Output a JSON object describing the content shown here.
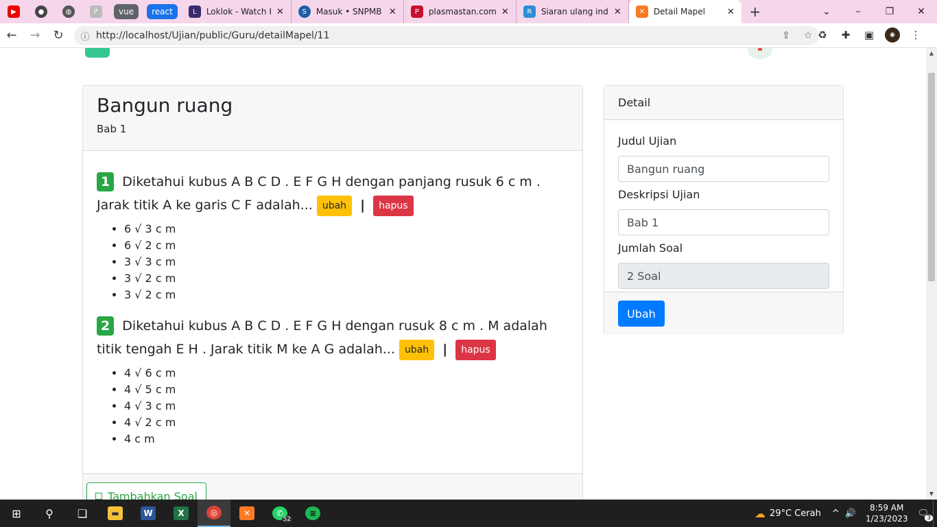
{
  "browser": {
    "pinned_icons": [
      "youtube-icon",
      "github-icon",
      "globe-icon",
      "react-devtools-icon"
    ],
    "tab_groups": [
      {
        "label": "vue",
        "color": "#5f6368"
      },
      {
        "label": "react",
        "color": "#1a73e8"
      }
    ],
    "tabs": [
      {
        "title": "Loklok - Watch HD",
        "icon": "loklok-icon"
      },
      {
        "title": "Masuk • SNPMB",
        "icon": "snpmb-icon"
      },
      {
        "title": "plasmastan.com | L",
        "icon": "plasmastan-icon"
      },
      {
        "title": "Siaran ulang indon",
        "icon": "siaran-icon"
      },
      {
        "title": "Detail Mapel",
        "icon": "xampp-icon",
        "active": true
      }
    ],
    "url": "http://localhost/Ujian/public/Guru/detailMapel/11",
    "accent": "#f6d6ea"
  },
  "page": {
    "title": "Bangun ruang",
    "subtitle": "Bab 1",
    "questions": [
      {
        "number": "1",
        "text": "Diketahui kubus A B C D . E F G H dengan panjang rusuk 6 c m . Jarak titik A ke garis C F adalah...",
        "options": [
          "6 √ 3 c m",
          "6 √ 2 c m",
          "3 √ 3 c m",
          "3 √ 2 c m",
          "3 √ 2 c m"
        ],
        "edit_label": "ubah",
        "delete_label": "hapus"
      },
      {
        "number": "2",
        "text": "Diketahui kubus A B C D . E F G H dengan rusuk 8 c m . M adalah titik tengah E H . Jarak titik M ke A G adalah...",
        "options": [
          "4 √ 6 c m",
          "4 √ 5 c m",
          "4 √ 3 c m",
          "4 √ 2 c m",
          "4 c m"
        ],
        "edit_label": "ubah",
        "delete_label": "hapus"
      }
    ],
    "separator": "|",
    "add_question_label": "Tambahkan Soal"
  },
  "detail": {
    "header": "Detail",
    "fields": [
      {
        "label": "Judul Ujian",
        "value": "Bangun ruang"
      },
      {
        "label": "Deskripsi Ujian",
        "value": "Bab 1"
      },
      {
        "label": "Jumlah Soal",
        "value": "2 Soal",
        "disabled": true
      }
    ],
    "submit_label": "Ubah"
  },
  "colors": {
    "success": "#28a745",
    "warning": "#ffc107",
    "danger": "#dc3545",
    "primary": "#007bff"
  },
  "taskbar": {
    "weather": "29°C  Cerah",
    "time": "8:59 AM",
    "date": "1/23/2023",
    "whatsapp_badge": "52",
    "notification_count": "3"
  }
}
